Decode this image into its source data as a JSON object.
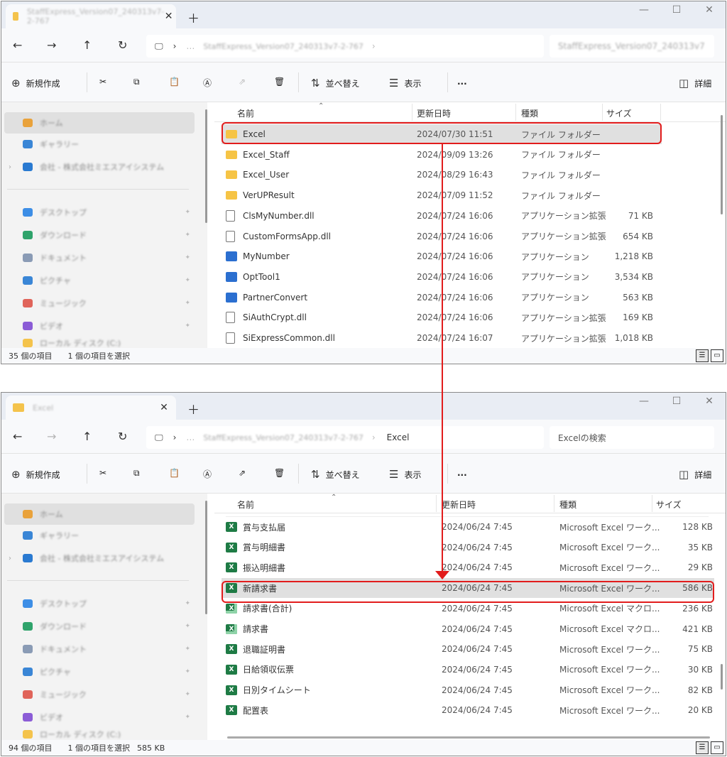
{
  "common": {
    "new_label": "新規作成",
    "sort_label": "並べ替え",
    "view_label": "表示",
    "more_label": "...",
    "details_label": "詳細",
    "columns": {
      "name": "名前",
      "modified": "更新日時",
      "type": "種類",
      "size": "サイズ"
    }
  },
  "window1": {
    "tab_title": "StaffExpress_Version07_240313v7-2-767",
    "address_path": "StaffExpress_Version07_240313v7-2-767",
    "search_placeholder": "StaffExpress_Version07_240313v7",
    "nav": [
      "ホーム",
      "ギャラリー",
      "会社 - 株式会社ミエスアイシステム",
      "デスクトップ",
      "ダウンロード",
      "ドキュメント",
      "ピクチャ",
      "ミュージック",
      "ビデオ",
      "ローカル ディスク (C:)"
    ],
    "files": [
      {
        "name": "Excel",
        "modified": "2024/07/30 11:51",
        "type": "ファイル フォルダー",
        "size": "",
        "icon": "folder-icon"
      },
      {
        "name": "Excel_Staff",
        "modified": "2024/09/09 13:26",
        "type": "ファイル フォルダー",
        "size": "",
        "icon": "folder-icon"
      },
      {
        "name": "Excel_User",
        "modified": "2024/08/29 16:43",
        "type": "ファイル フォルダー",
        "size": "",
        "icon": "folder-icon"
      },
      {
        "name": "VerUPResult",
        "modified": "2024/07/09 11:52",
        "type": "ファイル フォルダー",
        "size": "",
        "icon": "folder-icon"
      },
      {
        "name": "ClsMyNumber.dll",
        "modified": "2024/07/24 16:06",
        "type": "アプリケーション拡張",
        "size": "71 KB",
        "icon": "dll-icon"
      },
      {
        "name": "CustomFormsApp.dll",
        "modified": "2024/07/24 16:06",
        "type": "アプリケーション拡張",
        "size": "654 KB",
        "icon": "dll-icon"
      },
      {
        "name": "MyNumber",
        "modified": "2024/07/24 16:06",
        "type": "アプリケーション",
        "size": "1,218 KB",
        "icon": "app-icon"
      },
      {
        "name": "OptTool1",
        "modified": "2024/07/24 16:06",
        "type": "アプリケーション",
        "size": "3,534 KB",
        "icon": "app-icon"
      },
      {
        "name": "PartnerConvert",
        "modified": "2024/07/24 16:06",
        "type": "アプリケーション",
        "size": "563 KB",
        "icon": "app-icon"
      },
      {
        "name": "SiAuthCrypt.dll",
        "modified": "2024/07/24 16:06",
        "type": "アプリケーション拡張",
        "size": "169 KB",
        "icon": "dll-icon"
      },
      {
        "name": "SiExpressCommon.dll",
        "modified": "2024/07/24 16:07",
        "type": "アプリケーション拡張",
        "size": "1,018 KB",
        "icon": "dll-icon"
      }
    ],
    "status_count": "35 個の項目",
    "status_selected": "1 個の項目を選択"
  },
  "window2": {
    "tab_title": "Excel",
    "address_path": "StaffExpress_Version07_240313v7-2-767",
    "address_current": "Excel",
    "search_placeholder": "Excelの検索",
    "nav": [
      "ホーム",
      "ギャラリー",
      "会社 - 株式会社ミエスアイシステム",
      "デスクトップ",
      "ダウンロード",
      "ドキュメント",
      "ピクチャ",
      "ミュージック",
      "ビデオ",
      "ローカル ディスク (C:)"
    ],
    "files": [
      {
        "name": "賞与支払届",
        "modified": "2024/06/24 7:45",
        "type": "Microsoft Excel ワーク...",
        "size": "128 KB",
        "icon": "excel-icon"
      },
      {
        "name": "賞与明細書",
        "modified": "2024/06/24 7:45",
        "type": "Microsoft Excel ワーク...",
        "size": "35 KB",
        "icon": "excel-icon"
      },
      {
        "name": "振込明細書",
        "modified": "2024/06/24 7:45",
        "type": "Microsoft Excel ワーク...",
        "size": "29 KB",
        "icon": "excel-icon"
      },
      {
        "name": "新請求書",
        "modified": "2024/06/24 7:45",
        "type": "Microsoft Excel ワーク...",
        "size": "586 KB",
        "icon": "excel-icon"
      },
      {
        "name": "請求書(合計)",
        "modified": "2024/06/24 7:45",
        "type": "Microsoft Excel マクロ...",
        "size": "236 KB",
        "icon": "excel-macro-icon"
      },
      {
        "name": "請求書",
        "modified": "2024/06/24 7:45",
        "type": "Microsoft Excel マクロ...",
        "size": "421 KB",
        "icon": "excel-macro-icon"
      },
      {
        "name": "退職証明書",
        "modified": "2024/06/24 7:45",
        "type": "Microsoft Excel ワーク...",
        "size": "75 KB",
        "icon": "excel-icon"
      },
      {
        "name": "日給領収伝票",
        "modified": "2024/06/24 7:45",
        "type": "Microsoft Excel ワーク...",
        "size": "30 KB",
        "icon": "excel-icon"
      },
      {
        "name": "日別タイムシート",
        "modified": "2024/06/24 7:45",
        "type": "Microsoft Excel ワーク...",
        "size": "82 KB",
        "icon": "excel-icon"
      },
      {
        "name": "配置表",
        "modified": "2024/06/24 7:45",
        "type": "Microsoft Excel ワーク...",
        "size": "20 KB",
        "icon": "excel-icon"
      }
    ],
    "status_count": "94 個の項目",
    "status_selected": "1 個の項目を選択",
    "status_size": "585 KB"
  },
  "colors": {
    "highlight": "#e21c1c",
    "selected_row": "#e0e0e0",
    "folder": "#f6c445",
    "excel": "#1e7b45"
  }
}
